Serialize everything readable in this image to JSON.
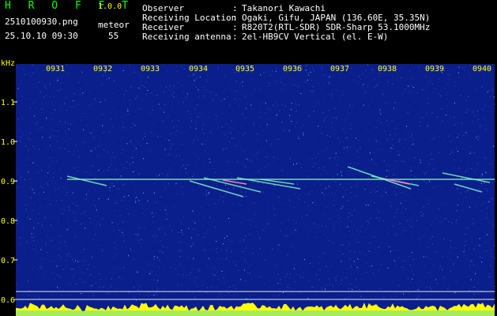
{
  "header": {
    "app_name": "H R O F F T",
    "version": "1.0.0",
    "filename": "2510100930.png",
    "datetime": "25.10.10 09:30",
    "meteor_label": "meteor",
    "meteor_count": "55",
    "fields": [
      {
        "key": "Observer",
        "sep": ":",
        "value": "Takanori Kawachi"
      },
      {
        "key": "Receiving Location",
        "sep": ":",
        "value": "Ogaki, Gifu, JAPAN (136.60E, 35.35N)"
      },
      {
        "key": "Receiver",
        "sep": ":",
        "value": "R820T2(RTL-SDR) SDR-Sharp 53.1000MHz"
      },
      {
        "key": "Receiving antenna",
        "sep": ":",
        "value": "2el-HB9CV Vertical (el. E-W)"
      }
    ]
  },
  "spectrogram": {
    "unit_label": "kHz",
    "time_ticks": [
      "0931",
      "0932",
      "0933",
      "0934",
      "0935",
      "0936",
      "0937",
      "0938",
      "0939",
      "0940"
    ],
    "freq_ticks": [
      "1.1",
      "1.0",
      "0.9",
      "0.8",
      "0.7",
      "0.6"
    ],
    "colors": {
      "background": "#0a1e8c",
      "noise": "#2f6bd6",
      "signal": "#7ff0c0",
      "strong": "#ff77cc",
      "axis_text": "#ffff00",
      "level_bar": "#ffff00"
    }
  }
}
